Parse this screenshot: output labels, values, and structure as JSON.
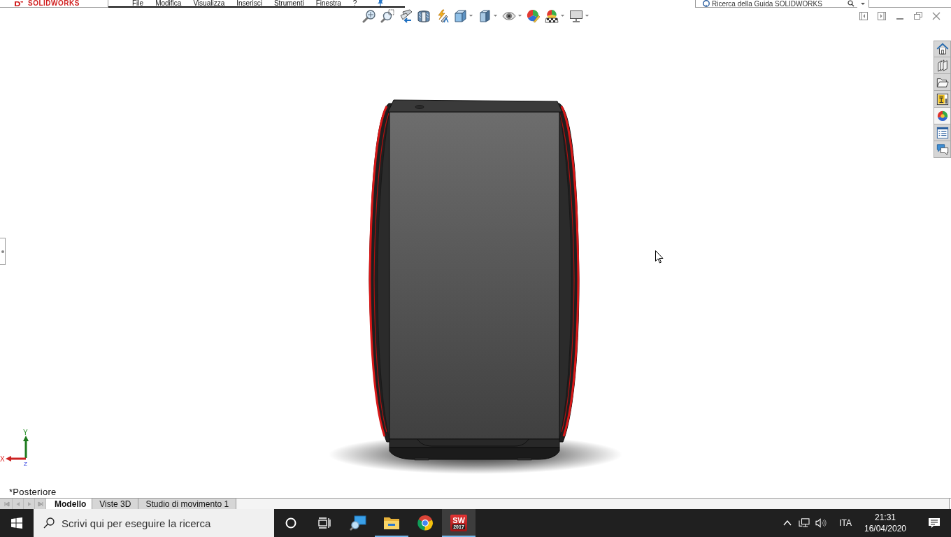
{
  "title_bar": {
    "logo": "SOLIDWORKS",
    "menu": [
      "File",
      "Modifica",
      "Visualizza",
      "Inserisci",
      "Strumenti",
      "Finestra",
      "?"
    ],
    "help_search": {
      "placeholder": "Ricerca della Guida SOLIDWORKS"
    }
  },
  "task_pane": {
    "tabs": [
      {
        "kind": "home",
        "selected": false
      },
      {
        "kind": "library",
        "selected": false
      },
      {
        "kind": "explorer",
        "selected": false
      },
      {
        "kind": "palette",
        "selected": false
      },
      {
        "kind": "appearances",
        "selected": true
      },
      {
        "kind": "properties",
        "selected": false
      },
      {
        "kind": "forum",
        "selected": false
      }
    ]
  },
  "viewport": {
    "triad": {
      "x_label": "X",
      "y_label": "Y",
      "z_label": "Z"
    },
    "view_name": "*Posteriore"
  },
  "tabs": [
    {
      "label": "Modello",
      "selected": true
    },
    {
      "label": "Viste 3D",
      "selected": false
    },
    {
      "label": "Studio di movimento 1",
      "selected": false
    }
  ],
  "taskbar": {
    "search": {
      "placeholder": "Scrivi qui per eseguire la ricerca"
    },
    "apps": [
      {
        "kind": "remote",
        "running": false,
        "selected": false
      },
      {
        "kind": "files",
        "running": true,
        "selected": false
      },
      {
        "kind": "browser",
        "running": false,
        "selected": false
      },
      {
        "kind": "cad",
        "running": true,
        "selected": true,
        "logo": "SW",
        "version": "2017"
      }
    ],
    "language": "ITA",
    "time": "21:31",
    "date": "16/04/2020"
  }
}
